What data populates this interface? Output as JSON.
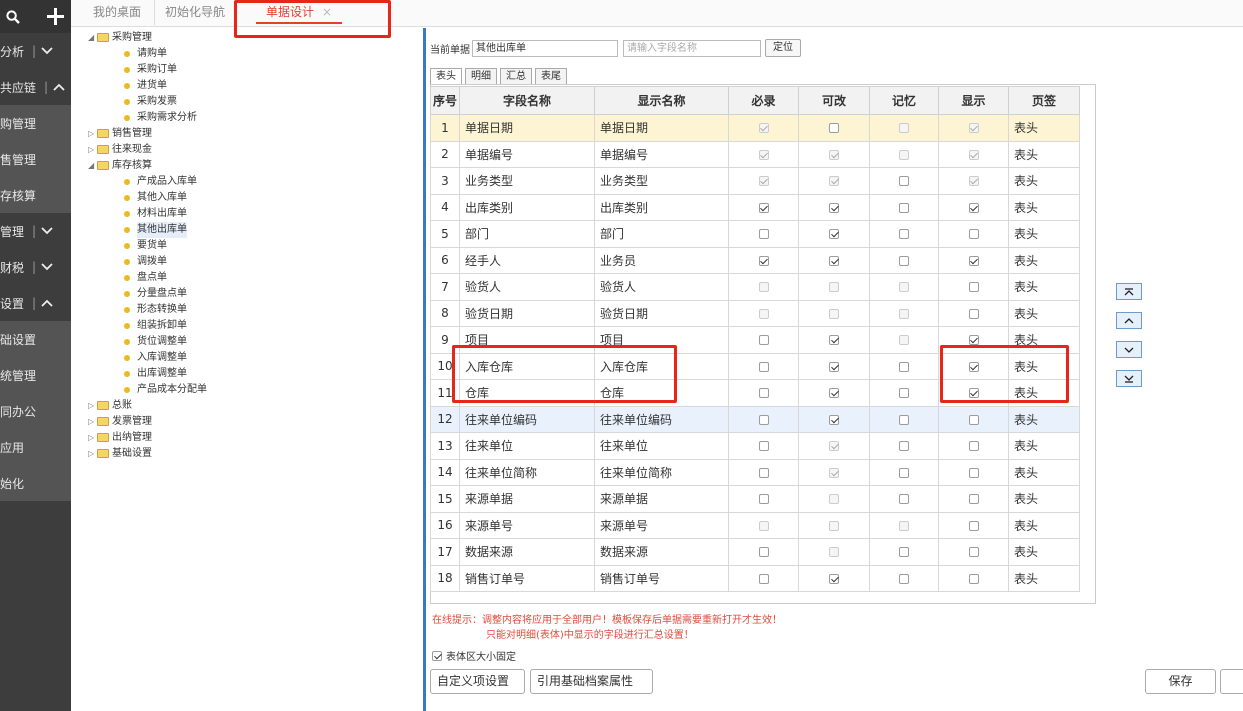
{
  "sidebar": {
    "items": [
      {
        "label": "分析",
        "type": "group",
        "chevron": "down"
      },
      {
        "label": "共应链",
        "type": "group",
        "chevron": "up"
      },
      {
        "label": "购管理",
        "type": "sub"
      },
      {
        "label": "售管理",
        "type": "sub"
      },
      {
        "label": "存核算",
        "type": "sub"
      },
      {
        "label": "管理",
        "type": "group",
        "chevron": "down"
      },
      {
        "label": "财税",
        "type": "group",
        "chevron": "down"
      },
      {
        "label": "设置",
        "type": "group",
        "chevron": "up"
      },
      {
        "label": "础设置",
        "type": "sub"
      },
      {
        "label": "统管理",
        "type": "sub"
      },
      {
        "label": "同办公",
        "type": "sub"
      },
      {
        "label": "应用",
        "type": "sub"
      },
      {
        "label": "始化",
        "type": "sub"
      }
    ]
  },
  "tabs": [
    {
      "label": "我的桌面"
    },
    {
      "label": "初始化导航"
    },
    {
      "label": "单据设计",
      "close": "×"
    }
  ],
  "tree": [
    {
      "label": "采购管理",
      "level": 0,
      "expanded": true
    },
    {
      "label": "请购单",
      "level": 1
    },
    {
      "label": "采购订单",
      "level": 1
    },
    {
      "label": "进货单",
      "level": 1
    },
    {
      "label": "采购发票",
      "level": 1
    },
    {
      "label": "采购需求分析",
      "level": 1
    },
    {
      "label": "销售管理",
      "level": 0,
      "expanded": false
    },
    {
      "label": "往来现金",
      "level": 0,
      "expanded": false
    },
    {
      "label": "库存核算",
      "level": 0,
      "expanded": true
    },
    {
      "label": "产成品入库单",
      "level": 1
    },
    {
      "label": "其他入库单",
      "level": 1
    },
    {
      "label": "材料出库单",
      "level": 1
    },
    {
      "label": "其他出库单",
      "level": 1,
      "selected": true
    },
    {
      "label": "要货单",
      "level": 1
    },
    {
      "label": "调拨单",
      "level": 1
    },
    {
      "label": "盘点单",
      "level": 1
    },
    {
      "label": "分量盘点单",
      "level": 1
    },
    {
      "label": "形态转换单",
      "level": 1
    },
    {
      "label": "组装拆卸单",
      "level": 1
    },
    {
      "label": "货位调整单",
      "level": 1
    },
    {
      "label": "入库调整单",
      "level": 1
    },
    {
      "label": "出库调整单",
      "level": 1
    },
    {
      "label": "产品成本分配单",
      "level": 1
    },
    {
      "label": "总账",
      "level": 0,
      "expanded": false
    },
    {
      "label": "发票管理",
      "level": 0,
      "expanded": false
    },
    {
      "label": "出纳管理",
      "level": 0,
      "expanded": false
    },
    {
      "label": "基础设置",
      "level": 0,
      "expanded": false
    }
  ],
  "form": {
    "current_label": "当前单据",
    "current_value": "其他出库单",
    "search_placeholder": "请输入字段名称",
    "locate_button": "定位"
  },
  "subtabs": [
    "表头",
    "明细",
    "汇总",
    "表尾"
  ],
  "table": {
    "headers": [
      "序号",
      "字段名称",
      "显示名称",
      "必录",
      "可改",
      "记忆",
      "显示",
      "页签"
    ],
    "rows": [
      {
        "no": "1",
        "field": "单据日期",
        "display": "单据日期",
        "req": "on-dis",
        "edit": "off",
        "mem": "off-dis",
        "show": "on-dis",
        "page": "表头",
        "state": "selected"
      },
      {
        "no": "2",
        "field": "单据编号",
        "display": "单据编号",
        "req": "on-dis",
        "edit": "on-dis",
        "mem": "off-dis",
        "show": "on-dis",
        "page": "表头"
      },
      {
        "no": "3",
        "field": "业务类型",
        "display": "业务类型",
        "req": "on-dis",
        "edit": "on-dis",
        "mem": "off",
        "show": "on-dis",
        "page": "表头"
      },
      {
        "no": "4",
        "field": "出库类别",
        "display": "出库类别",
        "req": "on",
        "edit": "on",
        "mem": "off",
        "show": "on",
        "page": "表头"
      },
      {
        "no": "5",
        "field": "部门",
        "display": "部门",
        "req": "off",
        "edit": "on",
        "mem": "off",
        "show": "off",
        "page": "表头"
      },
      {
        "no": "6",
        "field": "经手人",
        "display": "业务员",
        "req": "on",
        "edit": "on",
        "mem": "off",
        "show": "on",
        "page": "表头"
      },
      {
        "no": "7",
        "field": "验货人",
        "display": "验货人",
        "req": "off-dis",
        "edit": "off-dis",
        "mem": "off-dis",
        "show": "off",
        "page": "表头"
      },
      {
        "no": "8",
        "field": "验货日期",
        "display": "验货日期",
        "req": "off-dis",
        "edit": "off-dis",
        "mem": "off-dis",
        "show": "off",
        "page": "表头"
      },
      {
        "no": "9",
        "field": "项目",
        "display": "项目",
        "req": "off",
        "edit": "on",
        "mem": "off-dis",
        "show": "on",
        "page": "表头"
      },
      {
        "no": "10",
        "field": "入库仓库",
        "display": "入库仓库",
        "req": "off",
        "edit": "on",
        "mem": "off",
        "show": "on",
        "page": "表头"
      },
      {
        "no": "11",
        "field": "仓库",
        "display": "仓库",
        "req": "off",
        "edit": "on",
        "mem": "off",
        "show": "on",
        "page": "表头"
      },
      {
        "no": "12",
        "field": "往来单位编码",
        "display": "往来单位编码",
        "req": "off",
        "edit": "on",
        "mem": "off",
        "show": "off",
        "page": "表头",
        "state": "highlight"
      },
      {
        "no": "13",
        "field": "往来单位",
        "display": "往来单位",
        "req": "off",
        "edit": "on-dis",
        "mem": "off",
        "show": "off",
        "page": "表头"
      },
      {
        "no": "14",
        "field": "往来单位简称",
        "display": "往来单位简称",
        "req": "off",
        "edit": "on-dis",
        "mem": "off",
        "show": "off",
        "page": "表头"
      },
      {
        "no": "15",
        "field": "来源单据",
        "display": "来源单据",
        "req": "off",
        "edit": "off-dis",
        "mem": "off",
        "show": "off",
        "page": "表头"
      },
      {
        "no": "16",
        "field": "来源单号",
        "display": "来源单号",
        "req": "off-dis",
        "edit": "off-dis",
        "mem": "off-dis",
        "show": "off",
        "page": "表头"
      },
      {
        "no": "17",
        "field": "数据来源",
        "display": "数据来源",
        "req": "off",
        "edit": "off-dis",
        "mem": "off",
        "show": "off",
        "page": "表头"
      },
      {
        "no": "18",
        "field": "销售订单号",
        "display": "销售订单号",
        "req": "off",
        "edit": "on",
        "mem": "off",
        "show": "off",
        "page": "表头"
      }
    ]
  },
  "notice": {
    "line1": "在线提示：调整内容将应用于全部用户！模板保存后单据需要重新打开才生效！",
    "line2": "只能对明细(表体)中显示的字段进行汇总设置！"
  },
  "fixed_size": {
    "label": "表体区大小固定",
    "checked": true
  },
  "buttons": {
    "custom": "自定义项设置",
    "reference": "引用基础档案属性",
    "save": "保存"
  },
  "colors": {
    "sidebar_bg": "#3d3d3d",
    "accent_red": "#e6402d",
    "annotation_red": "#e8251b",
    "selected_row": "#fdf4d3",
    "highlight_row": "#e9f2fc",
    "divider_blue": "#3a78c3"
  }
}
